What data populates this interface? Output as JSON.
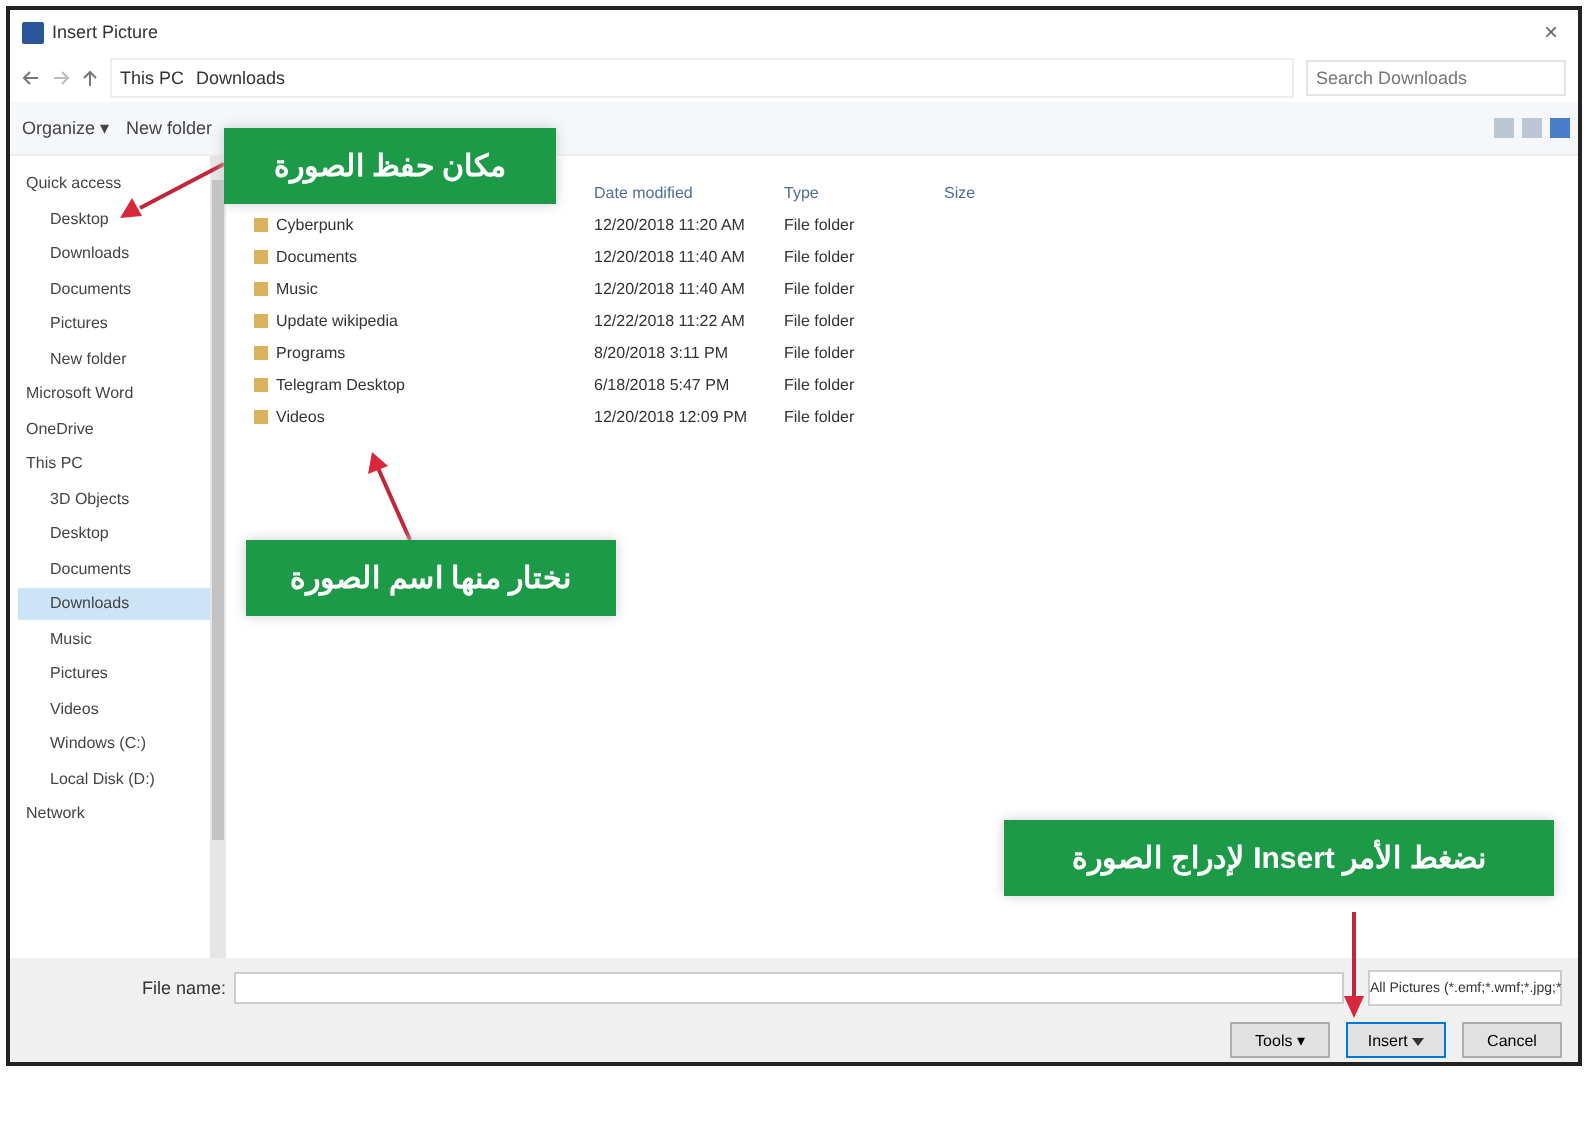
{
  "window": {
    "title": "Insert Picture",
    "close": "×"
  },
  "address": {
    "path": [
      "This PC",
      "Downloads"
    ],
    "search_placeholder": "Search Downloads"
  },
  "toolbar": {
    "organize": "Organize ▾",
    "new_folder": "New folder"
  },
  "sidebar": [
    {
      "label": "Quick access",
      "kind": "header",
      "selected": false
    },
    {
      "label": "Desktop",
      "kind": "pinned",
      "selected": false
    },
    {
      "label": "Downloads",
      "kind": "pinned",
      "selected": false
    },
    {
      "label": "Documents",
      "kind": "pinned",
      "selected": false
    },
    {
      "label": "Pictures",
      "kind": "pinned",
      "selected": false
    },
    {
      "label": "New folder",
      "kind": "pinned",
      "selected": false
    },
    {
      "label": "Microsoft Word",
      "kind": "header",
      "selected": false
    },
    {
      "label": "OneDrive",
      "kind": "header",
      "selected": false
    },
    {
      "label": "This PC",
      "kind": "header",
      "selected": false
    },
    {
      "label": "3D Objects",
      "kind": "item",
      "selected": false
    },
    {
      "label": "Desktop",
      "kind": "item",
      "selected": false
    },
    {
      "label": "Documents",
      "kind": "item",
      "selected": false
    },
    {
      "label": "Downloads",
      "kind": "item",
      "selected": true
    },
    {
      "label": "Music",
      "kind": "item",
      "selected": false
    },
    {
      "label": "Pictures",
      "kind": "item",
      "selected": false
    },
    {
      "label": "Videos",
      "kind": "item",
      "selected": false
    },
    {
      "label": "Windows (C:)",
      "kind": "item",
      "selected": false
    },
    {
      "label": "Local Disk (D:)",
      "kind": "item",
      "selected": false
    },
    {
      "label": "Network",
      "kind": "header",
      "selected": false
    }
  ],
  "table": {
    "columns": [
      "Date modified",
      "Type",
      "Size"
    ],
    "rows": [
      {
        "name": "Cyberpunk",
        "date": "12/20/2018 11:20 AM",
        "type": "File folder"
      },
      {
        "name": "Documents",
        "date": "12/20/2018 11:40 AM",
        "type": "File folder"
      },
      {
        "name": "Music",
        "date": "12/20/2018 11:40 AM",
        "type": "File folder"
      },
      {
        "name": "Update wikipedia",
        "date": "12/22/2018 11:22 AM",
        "type": "File folder"
      },
      {
        "name": "Programs",
        "date": "8/20/2018 3:11 PM",
        "type": "File folder"
      },
      {
        "name": "Telegram Desktop",
        "date": "6/18/2018 5:47 PM",
        "type": "File folder"
      },
      {
        "name": "Videos",
        "date": "12/20/2018 12:09 PM",
        "type": "File folder"
      }
    ]
  },
  "footer": {
    "file_name_label": "File name:",
    "file_type": "All Pictures (*.emf;*.wmf;*.jpg;*",
    "tools": "Tools ▾",
    "insert": "Insert",
    "cancel": "Cancel"
  },
  "callouts": [
    {
      "text": "مكان حفظ الصورة",
      "kind": "top"
    },
    {
      "text": "نختار منها اسم الصورة",
      "kind": "middle"
    },
    {
      "text": "نضغط الأمر Insert لإدراج الصورة",
      "kind": "bottom"
    }
  ]
}
